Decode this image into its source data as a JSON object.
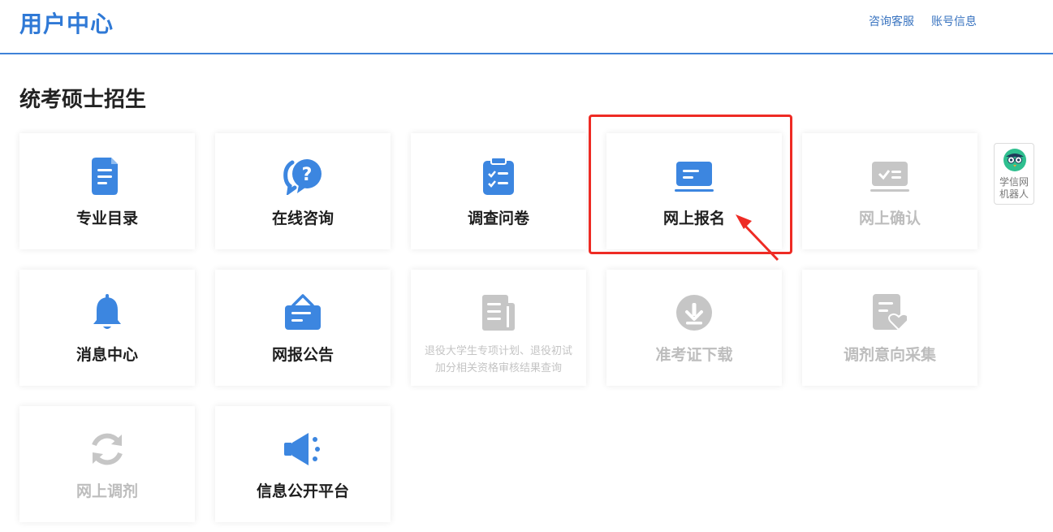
{
  "header": {
    "title": "用户中心",
    "nav": {
      "consult": "咨询客服",
      "account": "账号信息"
    }
  },
  "section": {
    "title": "统考硕士招生"
  },
  "colors": {
    "accent": "#3c86e0",
    "disabled": "#c6c6c6",
    "highlight": "#ee2b24"
  },
  "cards": [
    {
      "label": "专业目录",
      "icon": "document-bookmark-icon",
      "enabled": true
    },
    {
      "label": "在线咨询",
      "icon": "chat-question-icon",
      "enabled": true
    },
    {
      "label": "调查问卷",
      "icon": "clipboard-checklist-icon",
      "enabled": true
    },
    {
      "label": "网上报名",
      "icon": "laptop-icon",
      "enabled": true
    },
    {
      "label": "网上确认",
      "icon": "laptop-check-icon",
      "enabled": false
    },
    {
      "label": "消息中心",
      "icon": "bell-icon",
      "enabled": true
    },
    {
      "label": "网报公告",
      "icon": "bulletin-board-icon",
      "enabled": true
    },
    {
      "line1": "退役大学生专项计划、退役初试",
      "line2": "加分相关资格审核结果查询",
      "icon": "newspaper-icon",
      "enabled": false
    },
    {
      "label": "准考证下载",
      "icon": "download-circle-icon",
      "enabled": false
    },
    {
      "label": "调剂意向采集",
      "icon": "form-heart-icon",
      "enabled": false
    },
    {
      "label": "网上调剂",
      "icon": "refresh-arrows-icon",
      "enabled": false
    },
    {
      "label": "信息公开平台",
      "icon": "megaphone-icon",
      "enabled": true
    }
  ],
  "robot": {
    "line1": "学信网",
    "line2": "机器人"
  }
}
